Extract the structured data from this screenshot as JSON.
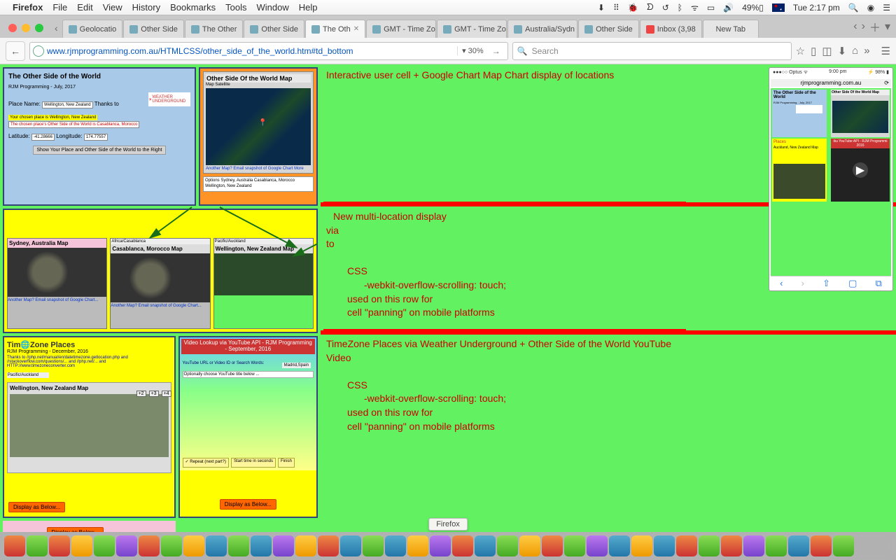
{
  "menubar": {
    "app": "Firefox",
    "items": [
      "File",
      "Edit",
      "View",
      "History",
      "Bookmarks",
      "Tools",
      "Window",
      "Help"
    ],
    "battery": "49%",
    "clock": "Tue 2:17 pm"
  },
  "tabs": [
    {
      "label": "Geolocatio"
    },
    {
      "label": "Other Side"
    },
    {
      "label": "The Other"
    },
    {
      "label": "Other Side"
    },
    {
      "label": "The Oth",
      "active": true
    },
    {
      "label": "GMT - Time Zo"
    },
    {
      "label": "GMT - Time Zo"
    },
    {
      "label": "Australia/Sydn"
    },
    {
      "label": "Other Side"
    },
    {
      "label": "Inbox (3,98"
    },
    {
      "label": "New Tab",
      "new": true
    }
  ],
  "url": "www.rjmprogramming.com.au/HTMLCSS/other_side_of_the_world.htm#td_bottom",
  "zoom": "30%",
  "search_placeholder": "Search",
  "row1": {
    "title": "The Other Side of the World",
    "subtitle": "RJM Programming - July, 2017",
    "placename": "Place Name:",
    "placeval": "Wellington, New Zealand",
    "thanks": "Thanks to",
    "wu": "WEATHER UNDERGROUND",
    "line2a": "Your chosen place is Wellington, New Zealand",
    "line2b": "The chosen place's Other Side of the World is Casablanca, Morocco",
    "lat": "Latitude:",
    "latv": "-41.28666",
    "lon": "Longitude:",
    "lonv": "174.77557",
    "btn": "Show Your Place and Other Side of the World to the Right",
    "maptitle": "Other Side Of the World Map",
    "mapbtns": "Map  Satellite",
    "maplinks": "Another Map?  Email snapshot of Google Chart   More",
    "selitems": "Options\\nSydney, Australia\\nCasablanca, Morocco\\nWellington, New Zealand"
  },
  "row2": {
    "m1": "Sydney, Australia Map",
    "m2": "Casablanca, Morocco Map",
    "m3": "Wellington, New Zealand Map",
    "tag1": "Africa/Casablanca",
    "tag2": "Pacific/Auckland",
    "tag3": "Pacific/Auckland",
    "links": "Another Map?  Email snapshot of Google Chart..."
  },
  "row3": {
    "tz_title": "Tim🌐Zone Places",
    "tz_sub": "RJM Programming - December, 2016",
    "tz_thanks": "Thanks to //php.net/manual/en/datetimezone.getlocation.php and //stackoverflow.com/questions/... and //php.net/... and HTTP://www.timezoneconverter.com",
    "tz_loc": "Pacific/Auckland",
    "tz_map": "Wellington, New Zealand Map",
    "plus": [
      "+2",
      "+3",
      "+4"
    ],
    "dab": "Display as Below...",
    "yt_title": "Video Lookup via YouTube API - RJM Programming - September, 2016",
    "yt_lbl": "YouTube URL or Video ID or Search Words:",
    "yt_val": "Madrid,Spain",
    "yt_opt": "Optionally choose YouTube title below ...",
    "yt_foot1": "✓ Repeat (next part?)",
    "yt_foot2": "Start time in seconds",
    "yt_foot3": "Finish"
  },
  "rtext": {
    "r1": "Interactive user cell + Google Chart Map Chart display of locations",
    "r2a": "New multi-location display",
    "r2b": "via",
    "r2c": "to",
    "css": "CSS",
    "cssrule": "-webkit-overflow-scrolling: touch;",
    "used": "used on this row for",
    "pan": "cell \"panning\" on mobile platforms",
    "r3": "TimeZone Places via Weather Underground + Other Side of the World YouTube Video"
  },
  "phone": {
    "carrier": "●●●○○ Optus ᯤ",
    "time": "9:00 pm",
    "batt": "⚡ 98% ▮",
    "url": "rjmprogramming.com.au",
    "bluetitle": "The Other Side of the World",
    "bluesub": "RJM Programming - July, 2017",
    "maptitle": "Other Side Of the World Map",
    "yel_title": "Places",
    "yel_loc": "Auckland, New Zealand Map",
    "vidtitle": "iku YouTube API - RJM Programmi 2016"
  },
  "dock": {
    "label": "Firefox",
    "count": 38
  }
}
